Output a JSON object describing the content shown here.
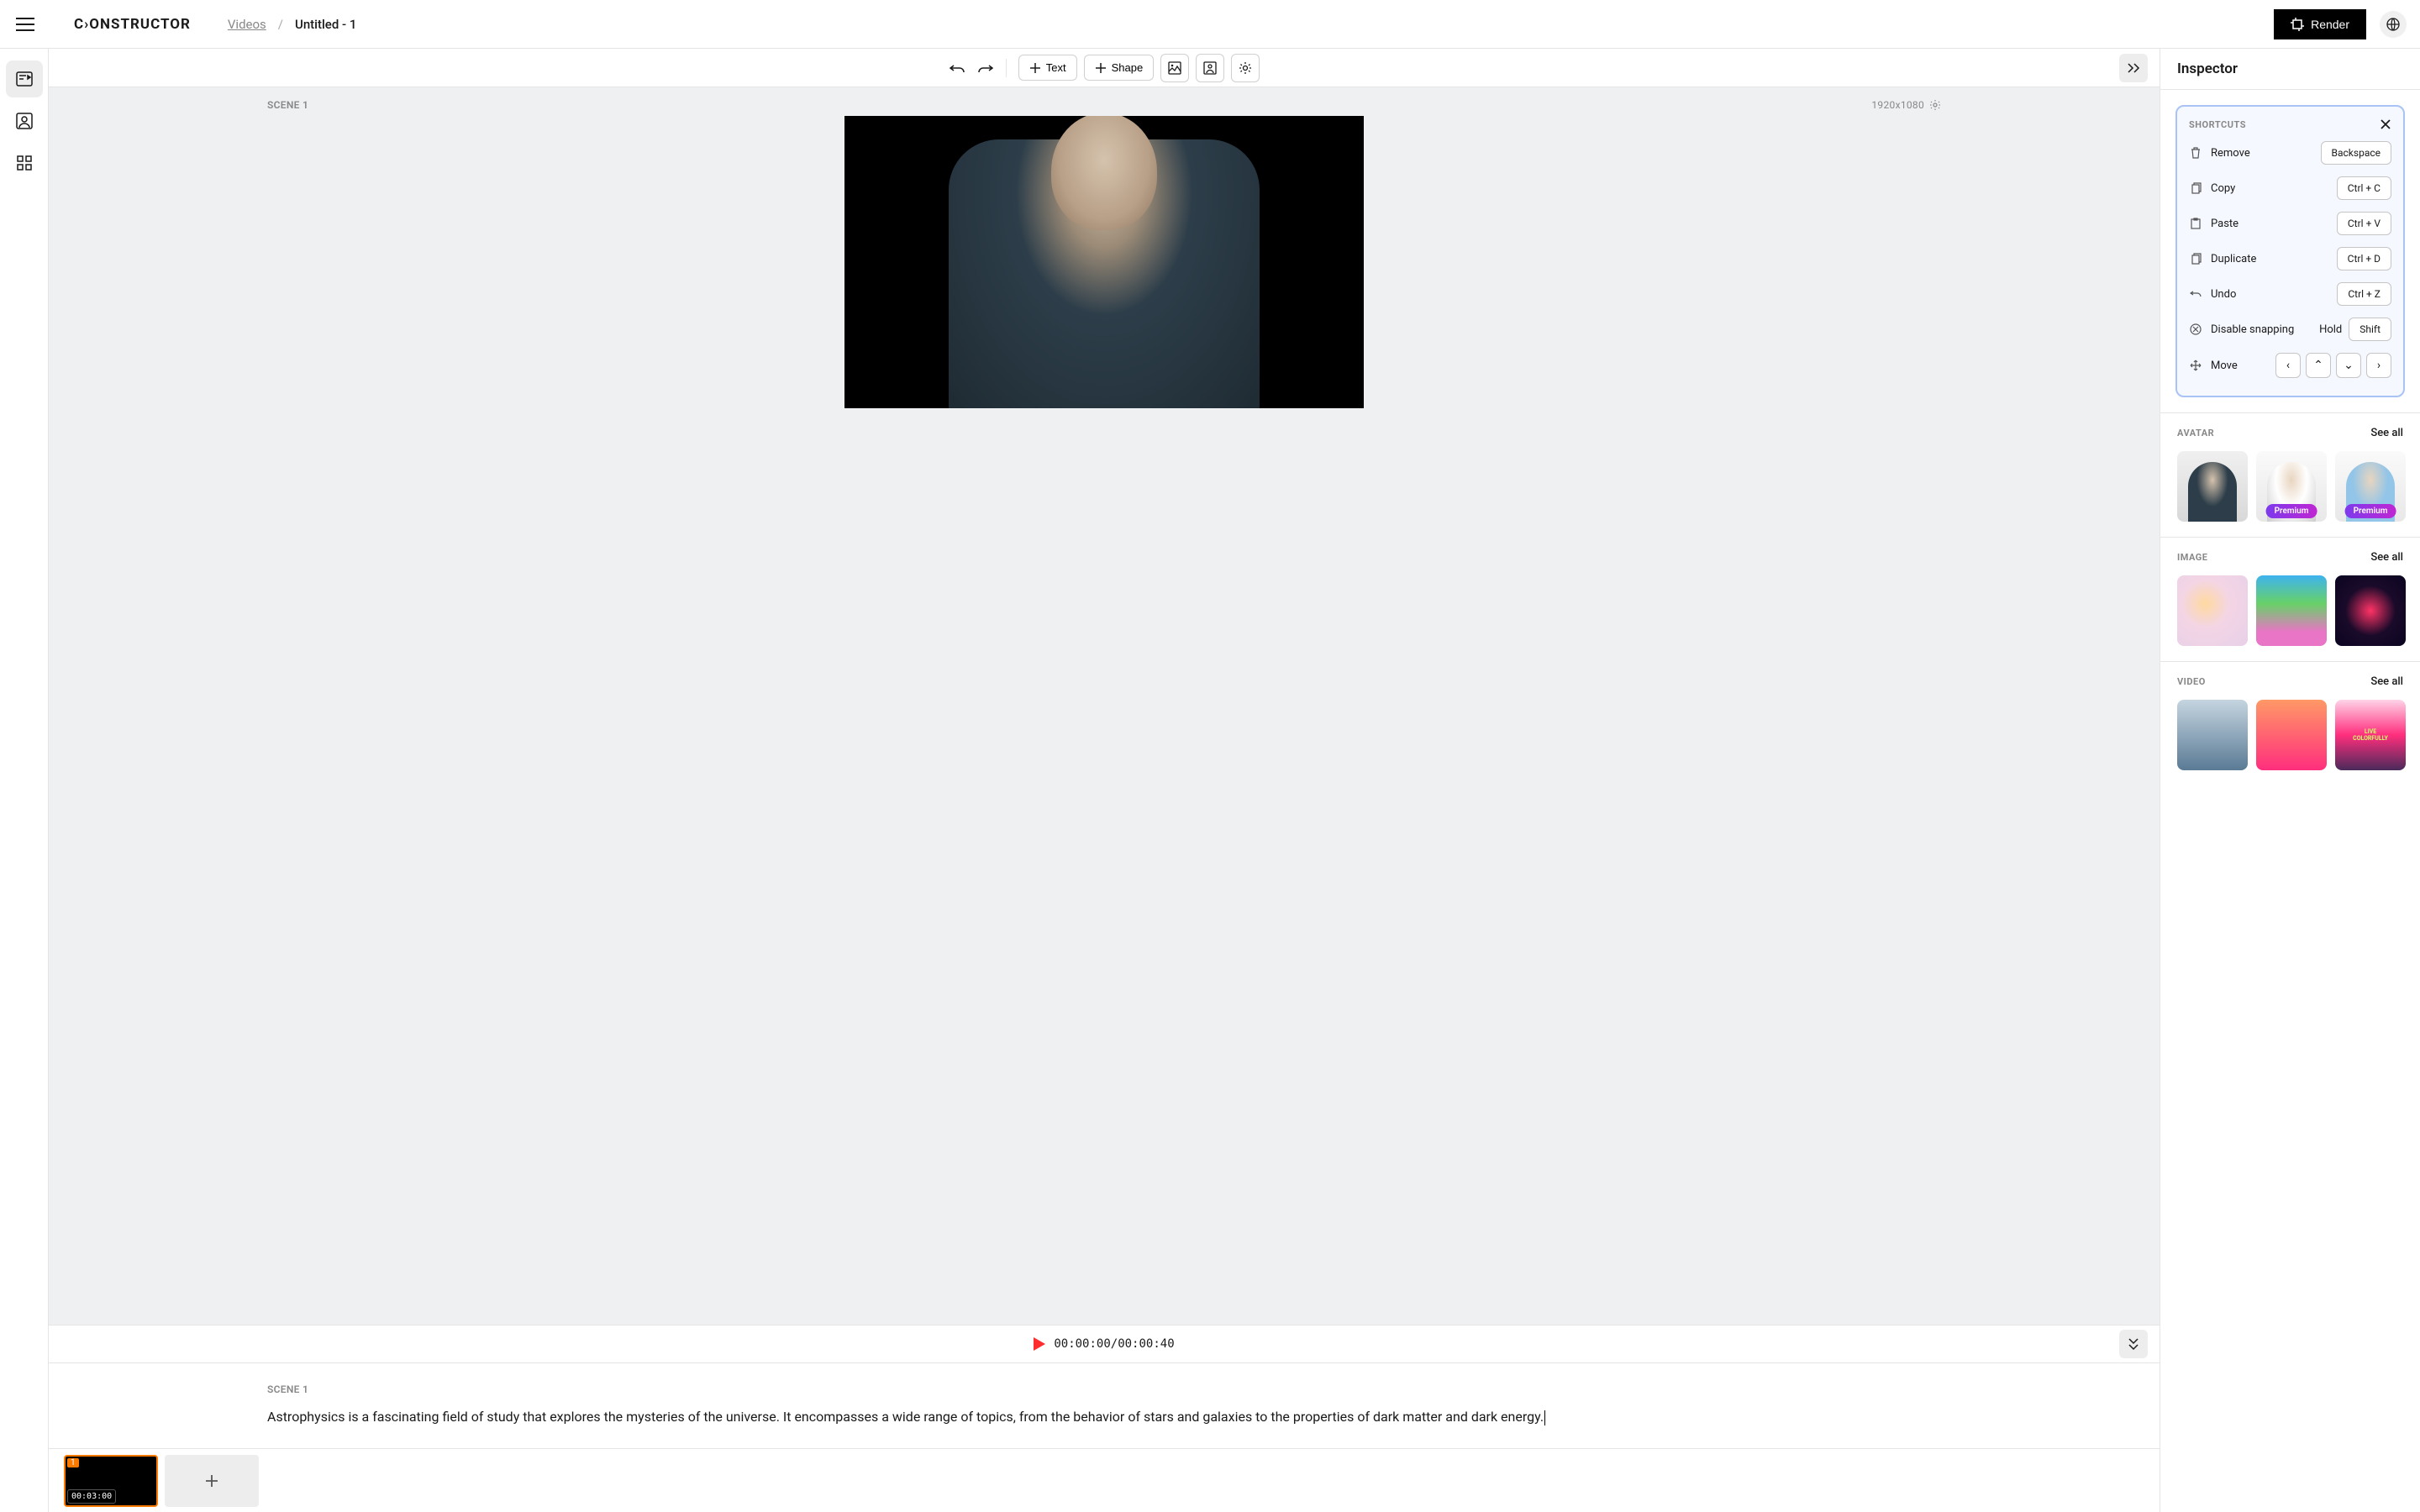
{
  "header": {
    "logo": "C›ONSTRUCTOR",
    "breadcrumb": {
      "parent": "Videos",
      "sep": "/",
      "current": "Untitled - 1"
    },
    "render_label": "Render"
  },
  "toolbar": {
    "text_label": "Text",
    "shape_label": "Shape"
  },
  "canvas": {
    "scene_label": "SCENE 1",
    "dimensions": "1920x1080"
  },
  "player": {
    "time": "00:00:00/00:00:40"
  },
  "script": {
    "label": "SCENE 1",
    "text": "Astrophysics is a fascinating field of study that explores the mysteries of the universe. It encompasses a wide range of topics, from the behavior of stars and galaxies to the properties of dark matter and dark energy."
  },
  "timeline": {
    "clip_num": "1",
    "clip_time": "00:03:00"
  },
  "inspector": {
    "title": "Inspector",
    "shortcuts": {
      "title": "SHORTCUTS",
      "items": [
        {
          "label": "Remove",
          "key": "Backspace"
        },
        {
          "label": "Copy",
          "key": "Ctrl + C"
        },
        {
          "label": "Paste",
          "key": "Ctrl + V"
        },
        {
          "label": "Duplicate",
          "key": "Ctrl + D"
        },
        {
          "label": "Undo",
          "key": "Ctrl + Z"
        }
      ],
      "snap_label": "Disable snapping",
      "snap_hold": "Hold",
      "snap_key": "Shift",
      "move_label": "Move"
    },
    "sections": {
      "avatar": {
        "title": "AVATAR",
        "see_all": "See all",
        "premium": "Premium"
      },
      "image": {
        "title": "IMAGE",
        "see_all": "See all"
      },
      "video": {
        "title": "VIDEO",
        "see_all": "See all",
        "colorful_text": "LIVE COLORFULLY"
      }
    }
  }
}
